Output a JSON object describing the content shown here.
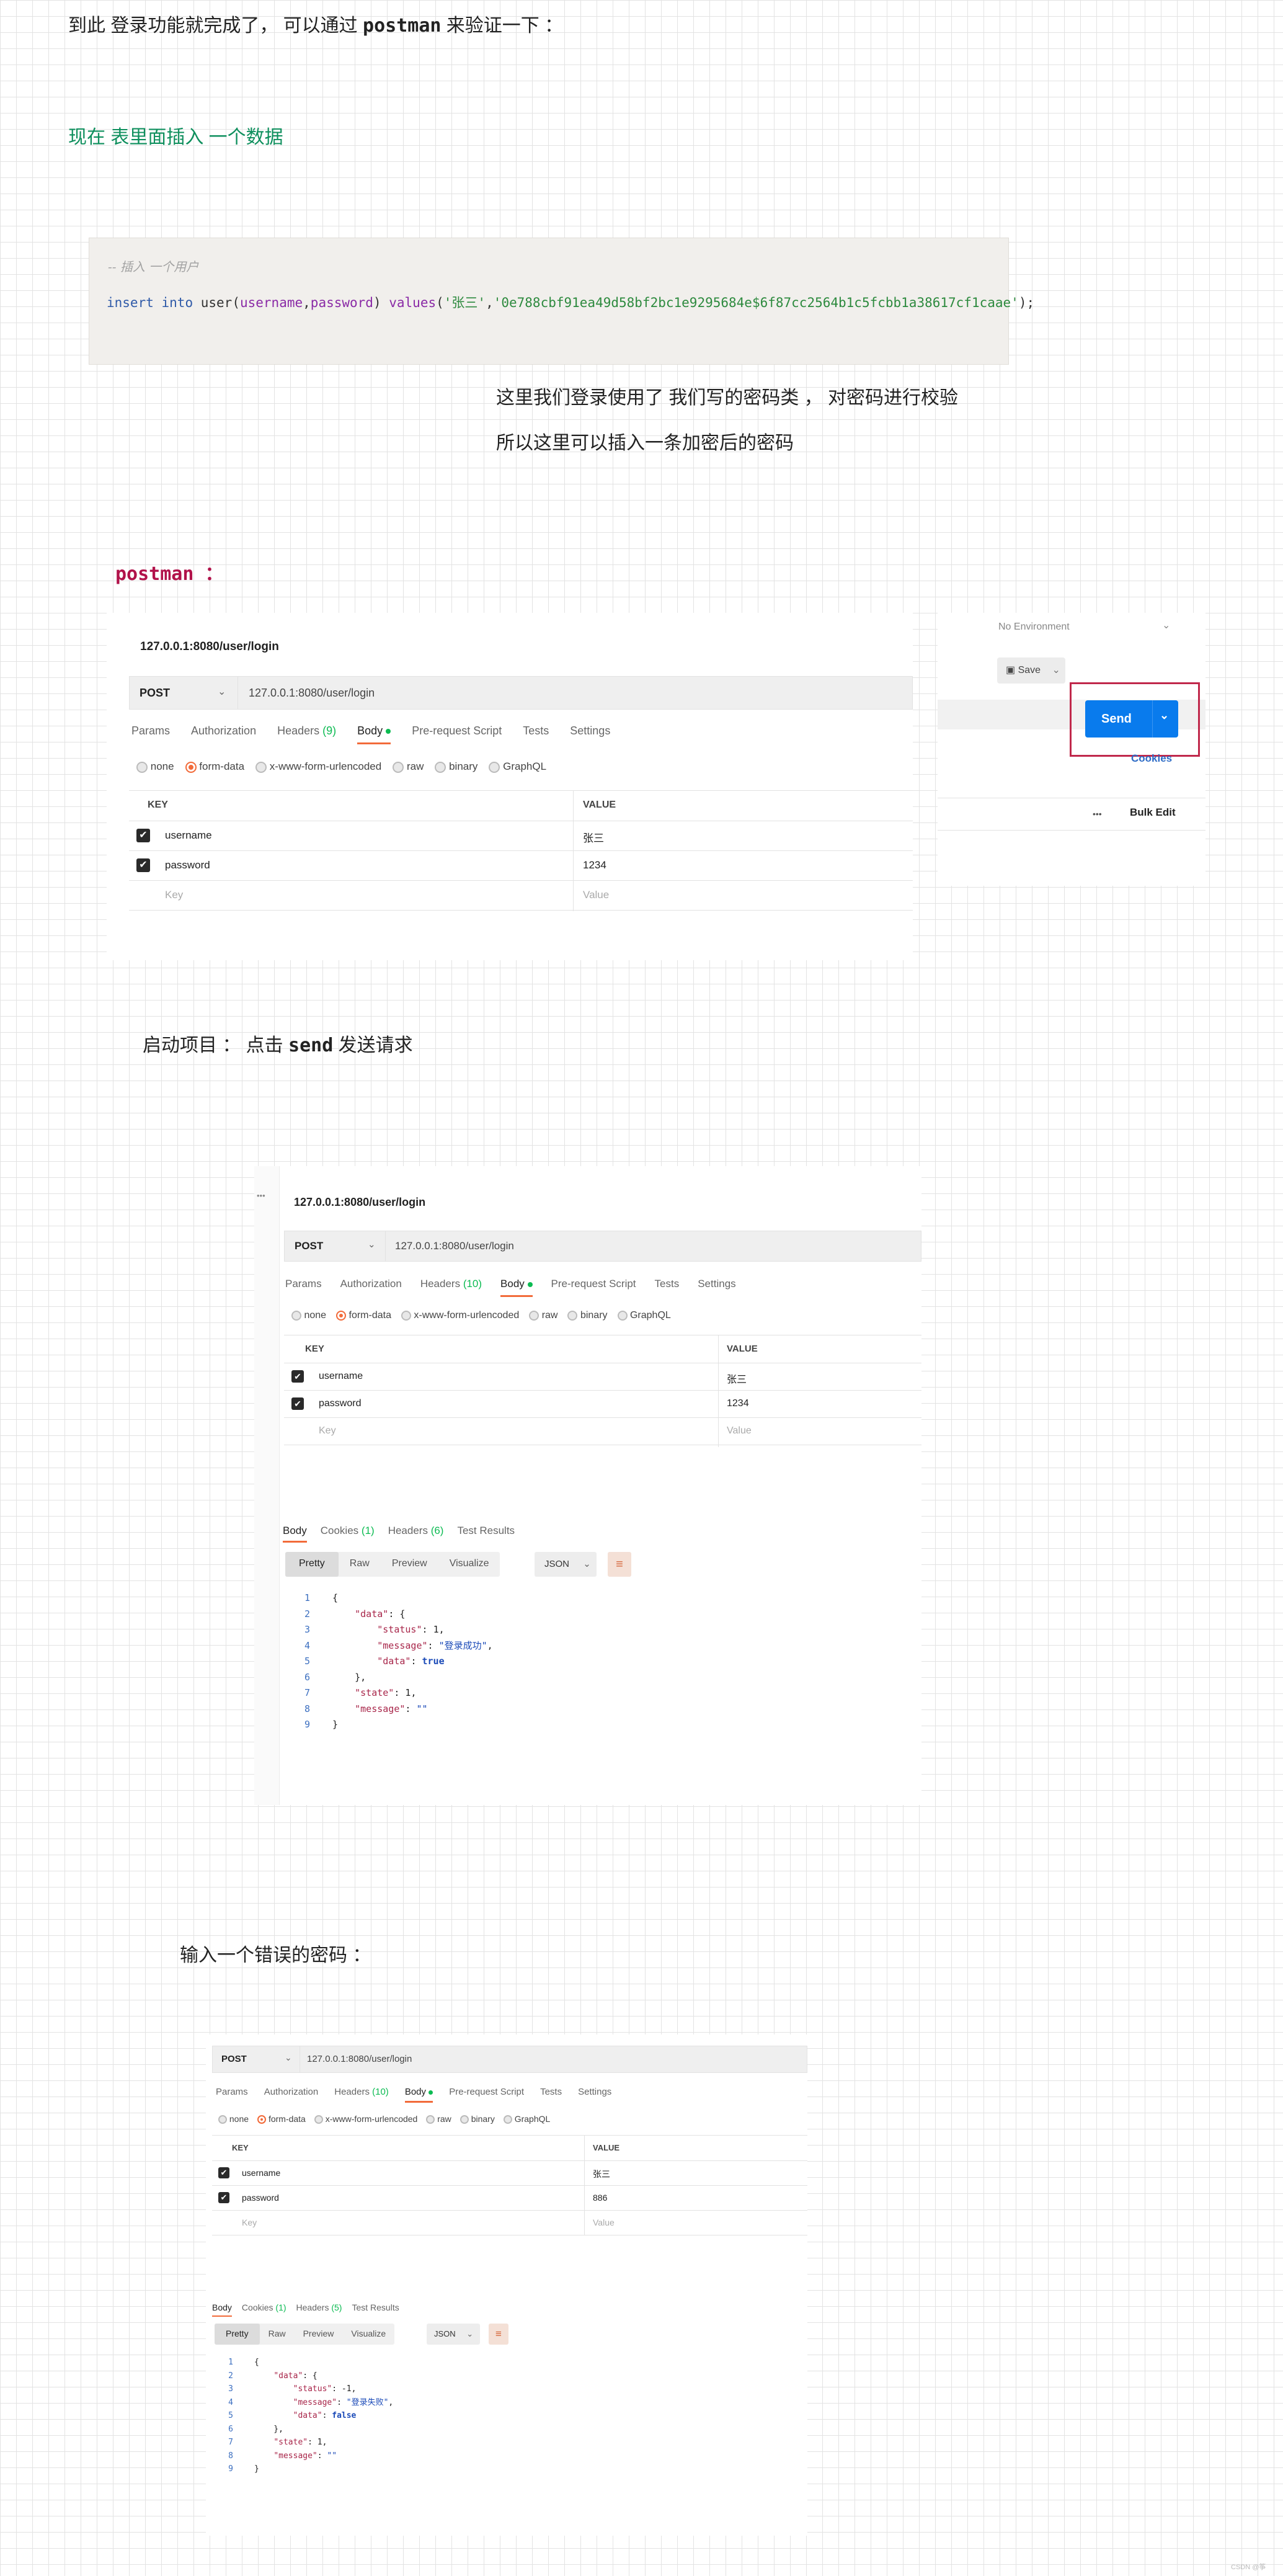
{
  "intro": {
    "text": "到此 登录功能就完成了， 可以通过",
    "code": "postman",
    "tail": "来验证一下 ："
  },
  "insert_heading": "现在 表里面插入 一个数据",
  "sql": {
    "comment": "-- 插入 一个用户",
    "line_kw1": "insert",
    "line_kw2": "into",
    "table": "user",
    "col1": "username",
    "col2": "password",
    "values_kw": "values",
    "val1": "'张三'",
    "val2": "'0e788cbf91ea49d58bf2bc1e9295684e$6f87cc2564b1c5fcbb1a38617cf1caae'",
    "tail": ");"
  },
  "notes": [
    "这里我们登录使用了 我们写的密码类 ， 对密码进行校验",
    "所以这里可以插入一条加密后的密码"
  ],
  "postman_label": "postman ：",
  "pm1": {
    "title": "127.0.0.1:8080/user/login",
    "method": "POST",
    "url": "127.0.0.1:8080/user/login",
    "tabs": [
      "Params",
      "Authorization",
      "Headers",
      "Body",
      "Pre-request Script",
      "Tests",
      "Settings"
    ],
    "headers_count": "(9)",
    "radios": [
      "none",
      "form-data",
      "x-www-form-urlencoded",
      "raw",
      "binary",
      "GraphQL"
    ],
    "col_key": "KEY",
    "col_value": "VALUE",
    "rows": [
      {
        "key": "username",
        "value": "张三"
      },
      {
        "key": "password",
        "value": "1234"
      }
    ],
    "ph_key": "Key",
    "ph_value": "Value"
  },
  "right_piece": {
    "env": "No Environment",
    "save": "Save",
    "send": "Send",
    "cookies": "Cookies",
    "bulk": "Bulk Edit",
    "dots": "•••"
  },
  "start_line": {
    "text": "启动项目 ： 点击",
    "code": "send",
    "tail": "发送请求"
  },
  "pm2": {
    "title": "127.0.0.1:8080/user/login",
    "method": "POST",
    "url": "127.0.0.1:8080/user/login",
    "tabs": [
      "Params",
      "Authorization",
      "Headers",
      "Body",
      "Pre-request Script",
      "Tests",
      "Settings"
    ],
    "headers_count": "(10)",
    "radios": [
      "none",
      "form-data",
      "x-www-form-urlencoded",
      "raw",
      "binary",
      "GraphQL"
    ],
    "col_key": "KEY",
    "col_value": "VALUE",
    "rows": [
      {
        "key": "username",
        "value": "张三"
      },
      {
        "key": "password",
        "value": "1234"
      }
    ],
    "ph_key": "Key",
    "ph_value": "Value",
    "resp_tabs": {
      "body": "Body",
      "cookies": "Cookies",
      "cookies_count": "(1)",
      "headers": "Headers",
      "headers_count": "(6)",
      "tests": "Test Results"
    },
    "views": [
      "Pretty",
      "Raw",
      "Preview",
      "Visualize"
    ],
    "format": "JSON",
    "status": "1",
    "message": "登录成功",
    "data": "true",
    "state": "1"
  },
  "wrong_heading": "输入一个错误的密码 ：",
  "pm3": {
    "method": "POST",
    "url": "127.0.0.1:8080/user/login",
    "tabs": [
      "Params",
      "Authorization",
      "Headers",
      "Body",
      "Pre-request Script",
      "Tests",
      "Settings"
    ],
    "headers_count": "(10)",
    "radios": [
      "none",
      "form-data",
      "x-www-form-urlencoded",
      "raw",
      "binary",
      "GraphQL"
    ],
    "col_key": "KEY",
    "col_value": "VALUE",
    "rows": [
      {
        "key": "username",
        "value": "张三"
      },
      {
        "key": "password",
        "value": "886"
      }
    ],
    "ph_key": "Key",
    "ph_value": "Value",
    "resp_tabs": {
      "body": "Body",
      "cookies": "Cookies",
      "cookies_count": "(1)",
      "headers": "Headers",
      "headers_count": "(5)",
      "tests": "Test Results"
    },
    "views": [
      "Pretty",
      "Raw",
      "Preview",
      "Visualize"
    ],
    "format": "JSON",
    "status": "-1",
    "message": "登录失败",
    "data": "false",
    "state": "1"
  },
  "watermark": "CSDN @筝"
}
